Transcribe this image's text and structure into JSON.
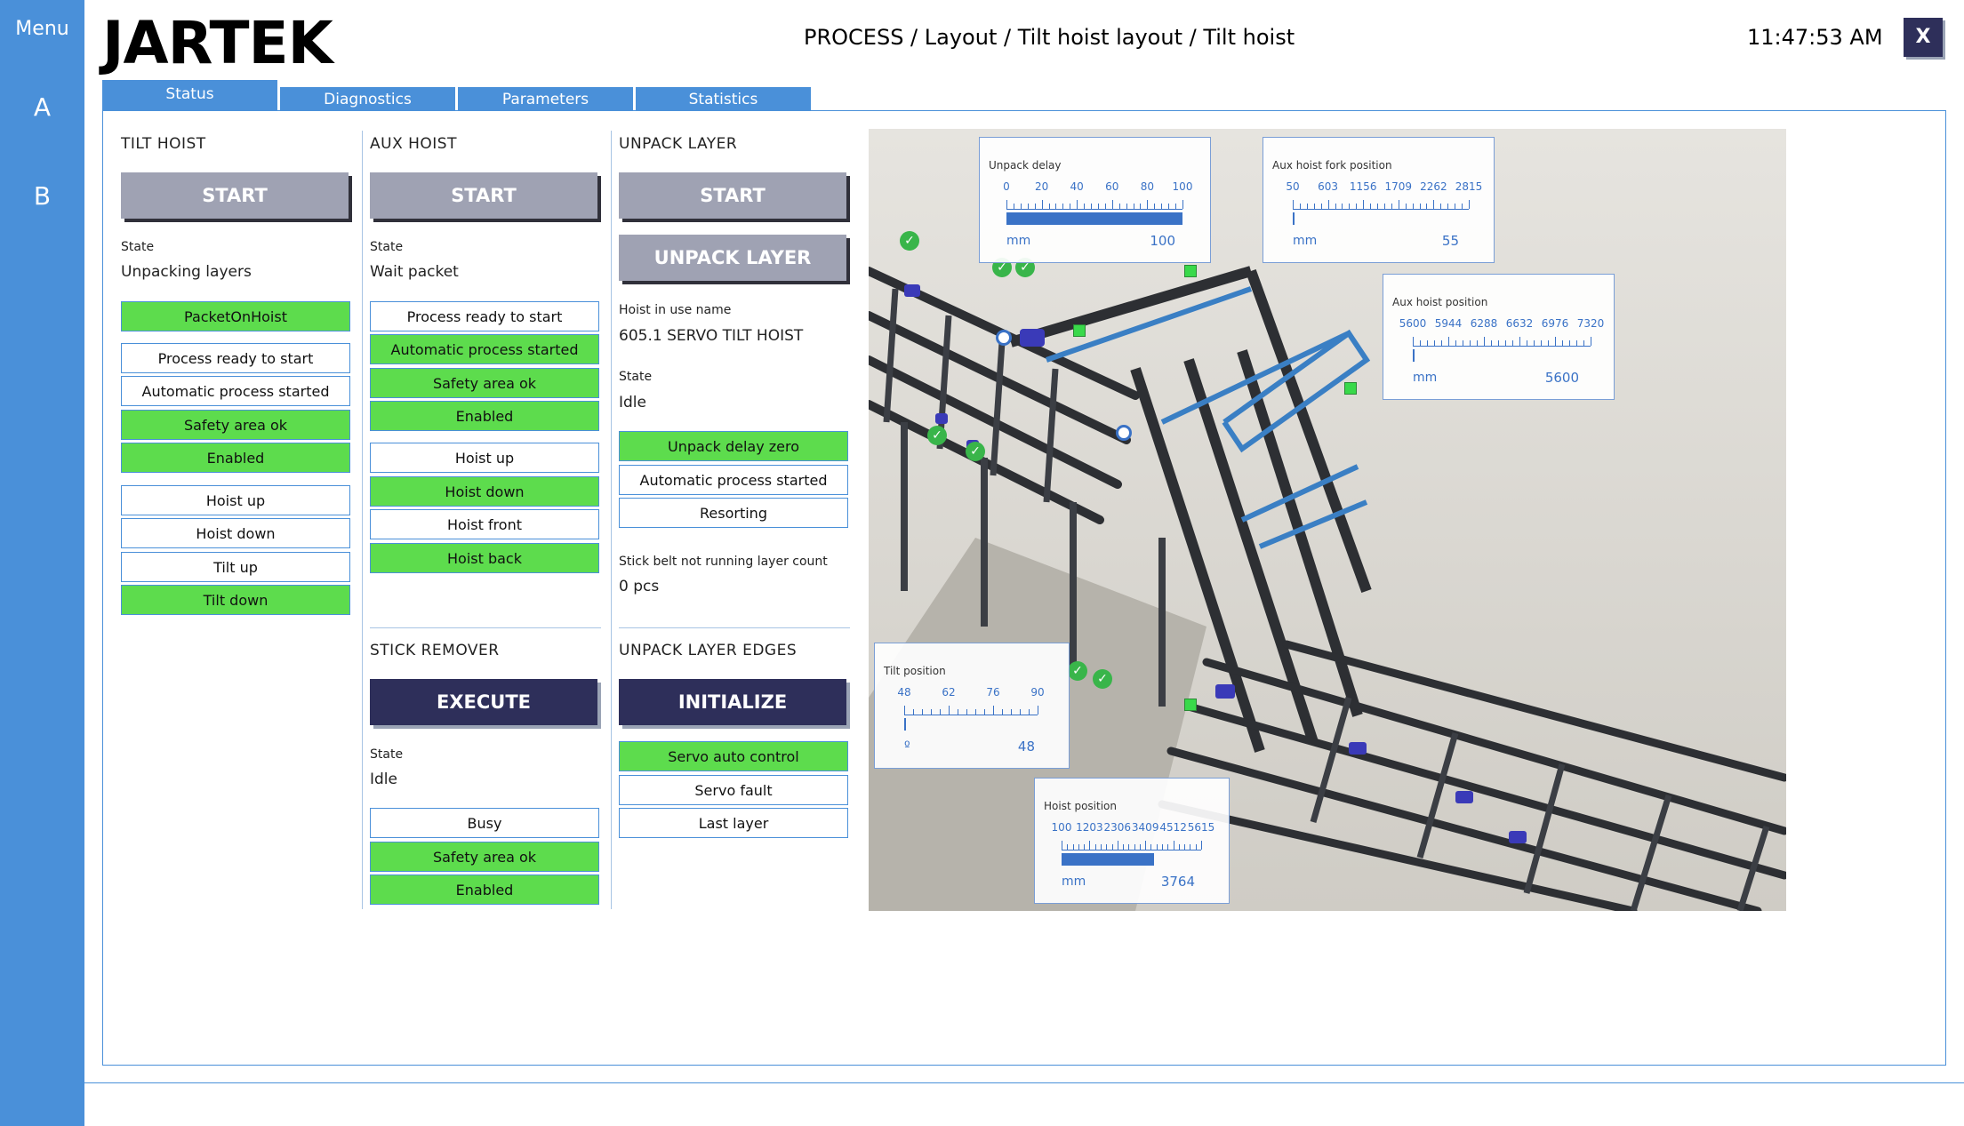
{
  "sidebar": {
    "menu": "Menu",
    "a": "A",
    "b": "B"
  },
  "logo": "JARTEK",
  "breadcrumb": "PROCESS / Layout / Tilt hoist layout / Tilt hoist",
  "clock": "11:47:53 AM",
  "close_label": "X",
  "tabs": [
    "Status",
    "Diagnostics",
    "Parameters",
    "Statistics"
  ],
  "tilt_hoist": {
    "title": "TILT HOIST",
    "start": "START",
    "state_label": "State",
    "state": "Unpacking layers",
    "signals": [
      {
        "label": "PacketOnHoist",
        "on": true
      },
      {
        "label": "Process ready to start",
        "on": false
      },
      {
        "label": "Automatic process started",
        "on": false
      },
      {
        "label": "Safety area ok",
        "on": true
      },
      {
        "label": "Enabled",
        "on": true
      },
      {
        "label": "Hoist up",
        "on": false
      },
      {
        "label": "Hoist down",
        "on": false
      },
      {
        "label": "Tilt up",
        "on": false
      },
      {
        "label": "Tilt down",
        "on": true
      }
    ]
  },
  "aux_hoist": {
    "title": "AUX HOIST",
    "start": "START",
    "state_label": "State",
    "state": "Wait packet",
    "signals": [
      {
        "label": "Process ready to start",
        "on": false
      },
      {
        "label": "Automatic process started",
        "on": true
      },
      {
        "label": "Safety area ok",
        "on": true
      },
      {
        "label": "Enabled",
        "on": true
      },
      {
        "label": "Hoist up",
        "on": false
      },
      {
        "label": "Hoist down",
        "on": true
      },
      {
        "label": "Hoist front",
        "on": false
      },
      {
        "label": "Hoist back",
        "on": true
      }
    ]
  },
  "unpack_layer": {
    "title": "UNPACK LAYER",
    "start": "START",
    "unpack": "UNPACK LAYER",
    "hoist_name_label": "Hoist in use name",
    "hoist_name": "605.1 SERVO TILT HOIST",
    "state_label": "State",
    "state": "Idle",
    "signals": [
      {
        "label": "Unpack delay zero",
        "on": true
      },
      {
        "label": "Automatic process started",
        "on": false
      },
      {
        "label": "Resorting",
        "on": false
      }
    ],
    "belt_label": "Stick belt not running layer count",
    "belt_value": "0 pcs"
  },
  "stick_remover": {
    "title": "STICK REMOVER",
    "execute": "EXECUTE",
    "state_label": "State",
    "state": "Idle",
    "signals": [
      {
        "label": "Busy",
        "on": false
      },
      {
        "label": "Safety area ok",
        "on": true
      },
      {
        "label": "Enabled",
        "on": true
      }
    ]
  },
  "unpack_edges": {
    "title": "UNPACK LAYER EDGES",
    "initialize": "INITIALIZE",
    "signals": [
      {
        "label": "Servo auto control",
        "on": true
      },
      {
        "label": "Servo fault",
        "on": false
      },
      {
        "label": "Last layer",
        "on": false
      }
    ]
  },
  "gauges": [
    {
      "title": "Unpack delay",
      "ticks": [
        "0",
        "20",
        "40",
        "60",
        "80",
        "100"
      ],
      "unit": "mm",
      "value": "100",
      "fill": 1.0
    },
    {
      "title": "Aux hoist fork position",
      "ticks": [
        "50",
        "603",
        "1156",
        "1709",
        "2262",
        "2815"
      ],
      "unit": "mm",
      "value": "55",
      "fill": 0.002
    },
    {
      "title": "Aux hoist position",
      "ticks": [
        "5600",
        "5944",
        "6288",
        "6632",
        "6976",
        "7320"
      ],
      "unit": "mm",
      "value": "5600",
      "fill": 0.0
    },
    {
      "title": "Tilt position",
      "ticks": [
        "48",
        "62",
        "76",
        "90"
      ],
      "unit": "º",
      "value": "48",
      "fill": 0.0
    },
    {
      "title": "Hoist position",
      "ticks": [
        "100",
        "1203",
        "2306",
        "3409",
        "4512",
        "5615"
      ],
      "unit": "mm",
      "value": "3764",
      "fill": 0.66
    }
  ],
  "colors": {
    "accent": "#4a90d9",
    "dark_button": "#2e2f5a",
    "grey_button": "#9fa2b3",
    "signal_on": "#5ddc4d"
  }
}
